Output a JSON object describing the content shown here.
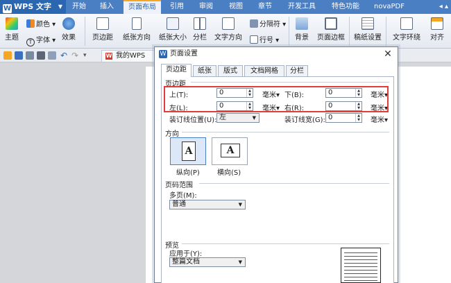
{
  "app": {
    "title": "WPS 文字"
  },
  "menu": {
    "tabs": [
      "开始",
      "插入",
      "页面布局",
      "引用",
      "审阅",
      "视图",
      "章节",
      "开发工具",
      "特色功能",
      "novaPDF"
    ],
    "active_index": 2
  },
  "ribbon": {
    "theme": "主题",
    "colors": "颜色",
    "fonts": "字体",
    "effects": "效果",
    "margins": "页边距",
    "orientation": "纸张方向",
    "size": "纸张大小",
    "columns": "分栏",
    "text_direction": "文字方向",
    "separator": "分隔符",
    "line_numbers": "行号",
    "background": "背景",
    "page_border": "页面边框",
    "manuscript": "稿纸设置",
    "text_wrap": "文字环绕",
    "align": "对齐"
  },
  "doc_tab": {
    "label": "我的WPS"
  },
  "dialog": {
    "title": "页面设置",
    "tabs": [
      "页边距",
      "纸张",
      "版式",
      "文档网格",
      "分栏"
    ],
    "active_tab": 0,
    "margins": {
      "group_label": "页边距",
      "top_label": "上(T):",
      "top_value": "0",
      "bottom_label": "下(B):",
      "bottom_value": "0",
      "left_label": "左(L):",
      "left_value": "0",
      "right_label": "右(R):",
      "right_value": "0",
      "unit": "毫米",
      "gutter_pos_label": "装订线位置(U):",
      "gutter_pos_value": "左",
      "gutter_width_label": "装订线宽(G):",
      "gutter_width_value": "0"
    },
    "orientation": {
      "group_label": "方向",
      "portrait": "纵向(P)",
      "landscape": "横向(S)",
      "glyph": "A"
    },
    "pages": {
      "group_label": "页码范围",
      "multiple_label": "多页(M):",
      "multiple_value": "普通"
    },
    "preview": {
      "group_label": "预览",
      "apply_label": "应用于(Y):",
      "apply_value": "整篇文档"
    }
  }
}
